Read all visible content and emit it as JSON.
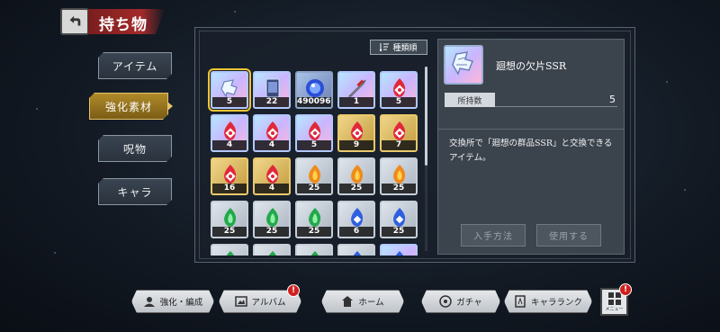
{
  "header": {
    "title": "持ち物"
  },
  "categories": [
    {
      "label": "アイテム",
      "active": false
    },
    {
      "label": "強化素材",
      "active": true
    },
    {
      "label": "呪物",
      "active": false
    },
    {
      "label": "キャラ",
      "active": false
    }
  ],
  "sort": {
    "label": "種類順"
  },
  "items": [
    {
      "count": "5",
      "rarity": "rainbow",
      "icon": "fragment-icon",
      "selected": true
    },
    {
      "count": "22",
      "rarity": "rainbow",
      "icon": "card-icon"
    },
    {
      "count": "4900962",
      "rarity": "blue",
      "icon": "orb-icon"
    },
    {
      "count": "1",
      "rarity": "rainbow",
      "icon": "sword-icon"
    },
    {
      "count": "5",
      "rarity": "rainbow",
      "icon": "red-flame-icon"
    },
    {
      "count": "4",
      "rarity": "rainbow",
      "icon": "red-flame-icon"
    },
    {
      "count": "4",
      "rarity": "rainbow",
      "icon": "red-flame-icon"
    },
    {
      "count": "5",
      "rarity": "rainbow",
      "icon": "red-flame-icon"
    },
    {
      "count": "9",
      "rarity": "gold",
      "icon": "red-flame-icon"
    },
    {
      "count": "7",
      "rarity": "gold",
      "icon": "red-flame-icon"
    },
    {
      "count": "16",
      "rarity": "gold",
      "icon": "red-flame-icon"
    },
    {
      "count": "4",
      "rarity": "gold",
      "icon": "red-flame-icon"
    },
    {
      "count": "25",
      "rarity": "silver",
      "icon": "orange-flame-icon"
    },
    {
      "count": "25",
      "rarity": "silver",
      "icon": "orange-flame-icon"
    },
    {
      "count": "25",
      "rarity": "silver",
      "icon": "orange-flame-icon"
    },
    {
      "count": "25",
      "rarity": "silver",
      "icon": "green-flame-icon"
    },
    {
      "count": "25",
      "rarity": "silver",
      "icon": "green-flame-icon"
    },
    {
      "count": "25",
      "rarity": "silver",
      "icon": "green-flame-icon"
    },
    {
      "count": "6",
      "rarity": "silver",
      "icon": "blue-flame-icon"
    },
    {
      "count": "25",
      "rarity": "silver",
      "icon": "blue-flame-icon"
    },
    {
      "count": "",
      "rarity": "silver",
      "icon": "green-flame-icon"
    },
    {
      "count": "",
      "rarity": "silver",
      "icon": "green-flame-icon"
    },
    {
      "count": "",
      "rarity": "silver",
      "icon": "green-flame-icon"
    },
    {
      "count": "",
      "rarity": "silver",
      "icon": "blue-flame-icon"
    },
    {
      "count": "",
      "rarity": "rainbow",
      "icon": "blue-flame-icon"
    }
  ],
  "detail": {
    "name": "廻想の欠片SSR",
    "owned_label": "所持数",
    "owned_value": "5",
    "description": "交換所で「廻想の群品SSR」と交換できるアイテム。",
    "acquire_label": "入手方法",
    "use_label": "使用する"
  },
  "nav": {
    "enhance": "強化・編成",
    "album": "アルバム",
    "home": "ホーム",
    "gacha": "ガチャ",
    "ranking": "キャラランク",
    "menu": "メニュー",
    "badge_mark": "!"
  },
  "colors": {
    "accent_gold": "#e3c46a",
    "title_red": "#a32a2a",
    "badge_red": "#d21f1f"
  }
}
